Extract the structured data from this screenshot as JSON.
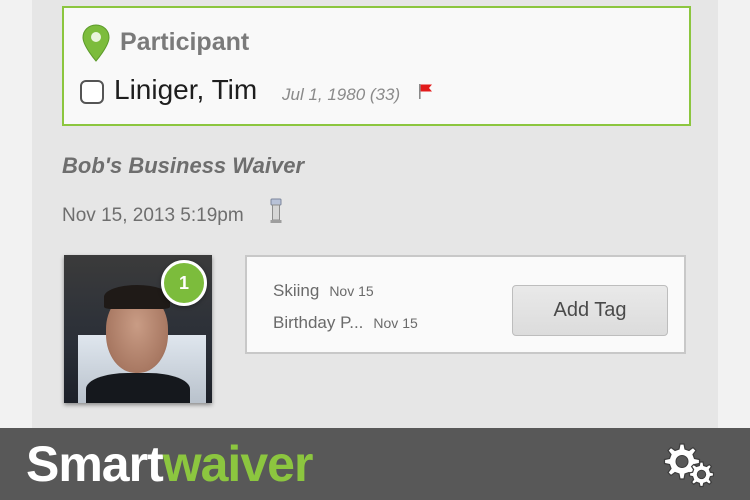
{
  "participant": {
    "title": "Participant",
    "name": "Liniger, Tim",
    "dob": "Jul 1, 1980 (33)",
    "checked": false
  },
  "waiver": {
    "title": "Bob's Business Waiver",
    "date": "Nov 15, 2013 5:19pm"
  },
  "photo": {
    "badge_count": "1"
  },
  "tags": [
    {
      "name": "Skiing",
      "date": "Nov 15"
    },
    {
      "name": "Birthday P...",
      "date": "Nov 15"
    }
  ],
  "actions": {
    "add_tag_label": "Add Tag"
  },
  "footer": {
    "brand_part1": "Smart",
    "brand_part2": "waiver"
  },
  "icons": {
    "location": "map-pin-icon",
    "flag": "flag-icon",
    "device": "device-icon",
    "settings": "gear-icon"
  },
  "colors": {
    "accent_green": "#8cc63f",
    "badge_green": "#7cbc3c",
    "flag_red": "#e21b1b",
    "footer_bg": "#585858"
  }
}
